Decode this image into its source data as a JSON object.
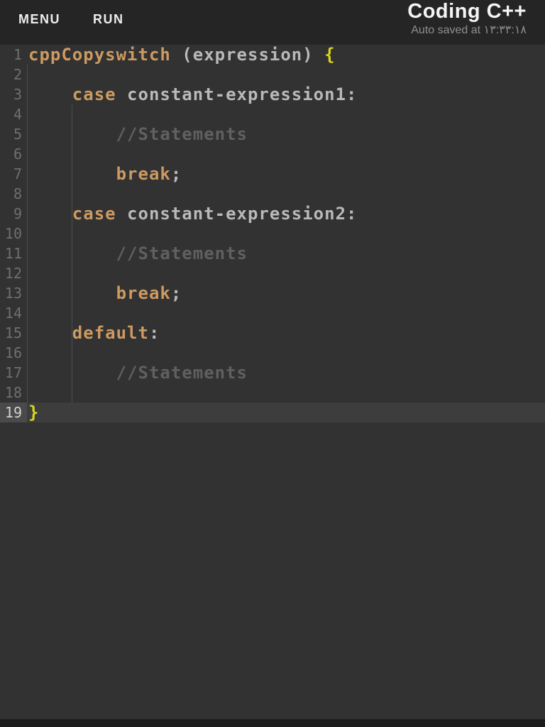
{
  "colors": {
    "header_bg": "#252525",
    "editor_bg": "#323232",
    "bottom_bar": "#1c1c1c",
    "keyword": "#cd9a62",
    "plain": "#b9b9b9",
    "comment": "#606060",
    "brace": "#d9d41f",
    "gutter_text": "#6f6f6f",
    "indent_guide": "#4d4d4d",
    "active_line_bg": "#3d3d3d",
    "active_gutter_bg": "#4a4a4a",
    "active_gutter_text": "#d2d2d2"
  },
  "header": {
    "menu_label": "MENU",
    "run_label": "RUN",
    "title": "Coding C++",
    "autosave_text": "Auto saved at ١٣:٣٣:١٨"
  },
  "editor": {
    "language": "cpp",
    "line_count": 19,
    "active_line": 19,
    "lines": [
      {
        "n": 1,
        "segments": [
          {
            "t": "cppCopyswitch",
            "c": "keyword"
          },
          {
            "t": " (expression) ",
            "c": "plain"
          },
          {
            "t": "{",
            "c": "brace"
          }
        ]
      },
      {
        "n": 2,
        "segments": []
      },
      {
        "n": 3,
        "segments": [
          {
            "t": "    ",
            "c": "plain"
          },
          {
            "t": "case",
            "c": "keyword"
          },
          {
            "t": " constant-expression1:",
            "c": "plain"
          }
        ]
      },
      {
        "n": 4,
        "segments": []
      },
      {
        "n": 5,
        "segments": [
          {
            "t": "        //Statements",
            "c": "comment"
          }
        ]
      },
      {
        "n": 6,
        "segments": []
      },
      {
        "n": 7,
        "segments": [
          {
            "t": "        ",
            "c": "plain"
          },
          {
            "t": "break",
            "c": "keyword"
          },
          {
            "t": ";",
            "c": "plain"
          }
        ]
      },
      {
        "n": 8,
        "segments": []
      },
      {
        "n": 9,
        "segments": [
          {
            "t": "    ",
            "c": "plain"
          },
          {
            "t": "case",
            "c": "keyword"
          },
          {
            "t": " constant-expression2:",
            "c": "plain"
          }
        ]
      },
      {
        "n": 10,
        "segments": []
      },
      {
        "n": 11,
        "segments": [
          {
            "t": "        //Statements",
            "c": "comment"
          }
        ]
      },
      {
        "n": 12,
        "segments": []
      },
      {
        "n": 13,
        "segments": [
          {
            "t": "        ",
            "c": "plain"
          },
          {
            "t": "break",
            "c": "keyword"
          },
          {
            "t": ";",
            "c": "plain"
          }
        ]
      },
      {
        "n": 14,
        "segments": []
      },
      {
        "n": 15,
        "segments": [
          {
            "t": "    ",
            "c": "plain"
          },
          {
            "t": "default",
            "c": "keyword"
          },
          {
            "t": ":",
            "c": "plain"
          }
        ]
      },
      {
        "n": 16,
        "segments": []
      },
      {
        "n": 17,
        "segments": [
          {
            "t": "        //Statements",
            "c": "comment"
          }
        ]
      },
      {
        "n": 18,
        "segments": []
      },
      {
        "n": 19,
        "segments": [
          {
            "t": "}",
            "c": "brace"
          }
        ],
        "active": true
      }
    ]
  }
}
